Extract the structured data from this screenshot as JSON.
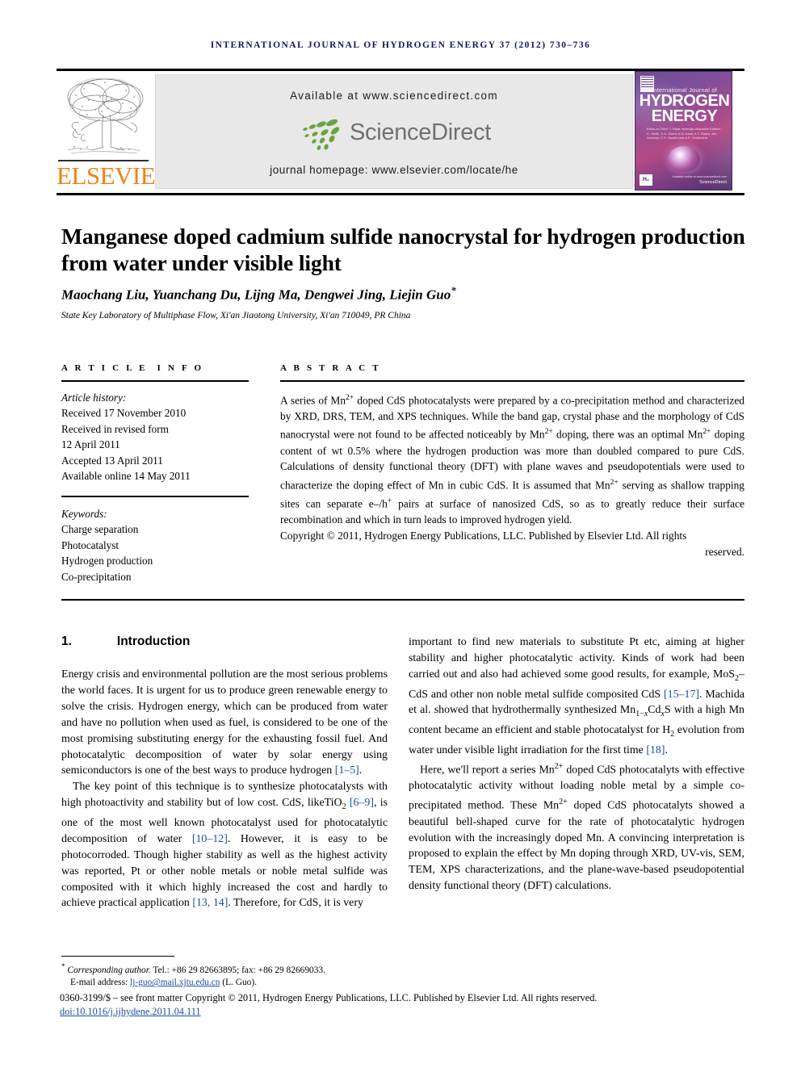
{
  "running_head": "International Journal of Hydrogen Energy 37 (2012) 730–736",
  "masthead": {
    "publisher_name": "ELSEVIER",
    "available_at": "Available at www.sciencedirect.com",
    "sciencedirect_word": "ScienceDirect",
    "journal_homepage": "journal homepage: www.elsevier.com/locate/he",
    "cover": {
      "line_small": "International Journal of",
      "line1": "HYDROGEN",
      "line2": "ENERGY",
      "editors": "Editor-in-Chief: T. Nejat Veziroğlu    Associate Editors: D. Smith, S.A. Sherif, A.M. Azad, A.T. Raissi, Jan Norbeck, C.S. Sandhi and A.R. Verlamkha",
      "hfi_mark": "H₂",
      "sciencedirect": "ScienceDirect",
      "sd_tagline": "Available online at www.sciencedirect.com"
    }
  },
  "article": {
    "title": "Manganese doped cadmium sulfide nanocrystal for hydrogen production from water under visible light",
    "authors": "Maochang Liu, Yuanchang Du, Lijng Ma, Dengwei Jing, Liejin Guo",
    "corresponding_marker": "*",
    "affiliation": "State Key Laboratory of Multiphase Flow, Xi'an Jiaotong University, Xi'an 710049, PR China"
  },
  "article_info": {
    "heading": "ARTICLE INFO",
    "history_label": "Article history:",
    "history": [
      "Received 17 November 2010",
      "Received in revised form",
      "12 April 2011",
      "Accepted 13 April 2011",
      "Available online 14 May 2011"
    ],
    "keywords_label": "Keywords:",
    "keywords": [
      "Charge separation",
      "Photocatalyst",
      "Hydrogen production",
      "Co-precipitation"
    ]
  },
  "abstract": {
    "heading": "ABSTRACT",
    "paragraph_html": "A series of Mn<sup>2+</sup> doped CdS photocatalysts were prepared by a co-precipitation method and characterized by XRD, DRS, TEM, and XPS techniques. While the band gap, crystal phase and the morphology of CdS nanocrystal were not found to be affected noticeably by Mn<sup>2+</sup> doping, there was an optimal Mn<sup>2+</sup> doping content of wt 0.5% where the hydrogen production was more than doubled compared to pure CdS. Calculations of density functional theory (DFT) with plane waves and pseudopotentials were used to characterize the doping effect of Mn in cubic CdS. It is assumed that Mn<sup>2+</sup> serving as shallow trapping sites can separate e–/h<sup>+</sup> pairs at surface of nanosized CdS, so as to greatly reduce their surface recombination and which in turn leads to improved hydrogen yield.",
    "copyright_html": "Copyright © 2011, Hydrogen Energy Publications, LLC. Published by Elsevier Ltd. All rights",
    "copyright_tail": "reserved."
  },
  "body": {
    "section_number": "1.",
    "section_title": "Introduction",
    "left_paragraphs_html": [
      "Energy crisis and environmental pollution are the most serious problems the world faces. It is urgent for us to produce green renewable energy to solve the crisis. Hydrogen energy, which can be produced from water and have no pollution when used as fuel, is considered to be one of the most promising substituting energy for the exhausting fossil fuel. And photocatalytic decomposition of water by solar energy using semiconductors is one of the best ways to produce hydrogen <span class=\"ref\">[1–5]</span>.",
      "The key point of this technique is to synthesize photocatalysts with high photoactivity and stability but of low cost. CdS, likeTiO<sub>2</sub> <span class=\"ref\">[6–9]</span>, is one of the most well known photocatalyst used for photocatalytic decomposition of water <span class=\"ref\">[10–12]</span>. However, it is easy to be photocorroded. Though higher stability as well as the highest activity was reported, Pt or other noble metals or noble metal sulfide was composited with it which highly increased the cost and hardly to achieve practical application <span class=\"ref\">[13, 14]</span>. Therefore, for CdS, it is very"
    ],
    "right_paragraphs_html": [
      "important to find new materials to substitute Pt etc, aiming at higher stability and higher photocatalytic activity. Kinds of work had been carried out and also had achieved some good results, for example, MoS<sub>2</sub>–CdS and other non noble metal sulfide composited CdS <span class=\"ref\">[15–17]</span>. Machida et al. showed that hydrothermally synthesized Mn<sub>1−<i>x</i></sub>Cd<sub><i>x</i></sub>S with a high Mn content became an efficient and stable photocatalyst for H<sub>2</sub> evolution from water under visible light irradiation for the first time <span class=\"ref\">[18]</span>.",
      "Here, we'll report a series Mn<sup>2+</sup> doped CdS photocatalyts with effective photocatalytic activity without loading noble metal by a simple co-precipitated method. These Mn<sup>2+</sup> doped CdS photocatalyts showed a beautiful bell-shaped curve for the rate of photocatalytic hydrogen evolution with the increasingly doped Mn. A convincing interpretation is proposed to explain the effect by Mn doping through XRD, UV-vis, SEM, TEM, XPS characterizations, and the plane-wave-based pseudopotential density functional theory (DFT) calculations."
    ]
  },
  "footer": {
    "corresponding_html": "<span class=\"star\">*</span> <i>Corresponding author.</i> Tel.: +86 29 82663895; fax: +86 29 82669033.",
    "email_label": "E-mail address:",
    "email": "lj-guo@mail.xjtu.edu.cn",
    "email_suffix": "(L. Guo).",
    "imprint": "0360-3199/$ – see front matter Copyright © 2011, Hydrogen Energy Publications, LLC. Published by Elsevier Ltd. All rights reserved.",
    "doi": "doi:10.1016/j.ijhydene.2011.04.111"
  },
  "colors": {
    "elsevier_orange": "#f0811a",
    "link_blue": "#1a4fa0",
    "running_head_navy": "#151560",
    "sciencedirect_green": "#6aa341",
    "sciencedirect_gray": "#6e7170"
  }
}
